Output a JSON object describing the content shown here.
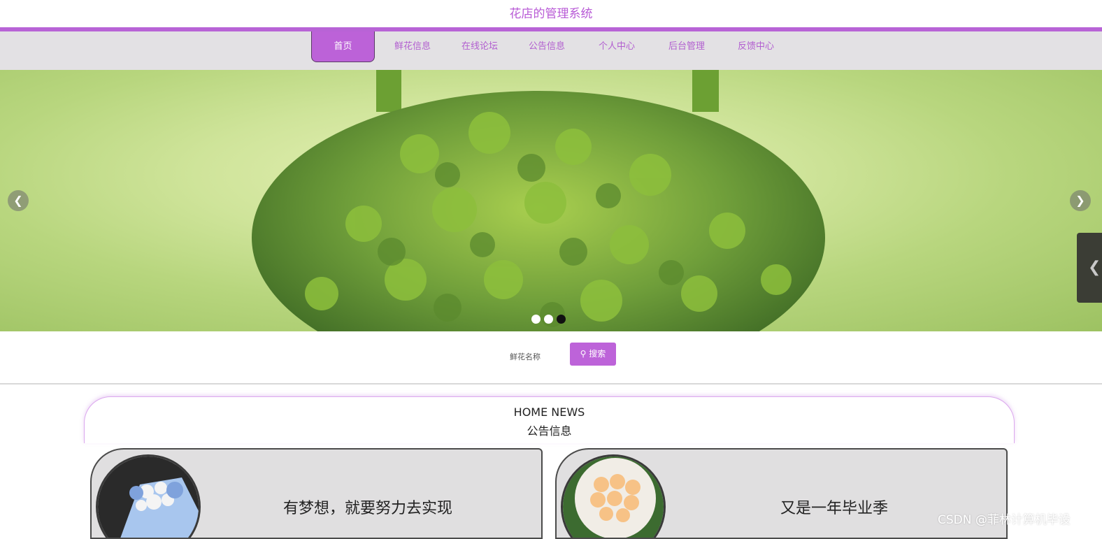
{
  "header": {
    "title": "花店的管理系统"
  },
  "nav": {
    "items": [
      {
        "label": "首页"
      },
      {
        "label": "鲜花信息"
      },
      {
        "label": "在线论坛"
      },
      {
        "label": "公告信息"
      },
      {
        "label": "个人中心"
      },
      {
        "label": "后台管理"
      },
      {
        "label": "反馈中心"
      }
    ],
    "active": "首页"
  },
  "carousel": {
    "prev_icon": "chevron-left-icon",
    "next_icon": "chevron-right-icon",
    "slide_count": 3,
    "current": 3
  },
  "search": {
    "label": "鲜花名称",
    "button_label": "搜索"
  },
  "news": {
    "heading_en": "HOME NEWS",
    "heading_cn": "公告信息",
    "cards": [
      {
        "title": "有梦想，就要努力去实现"
      },
      {
        "title": "又是一年毕业季"
      }
    ]
  },
  "watermark": "CSDN @菲林计算机毕设",
  "colors": {
    "accent": "#bc62d8",
    "nav_bg": "#e3e1e4",
    "card_bg": "#e0dfe0"
  }
}
